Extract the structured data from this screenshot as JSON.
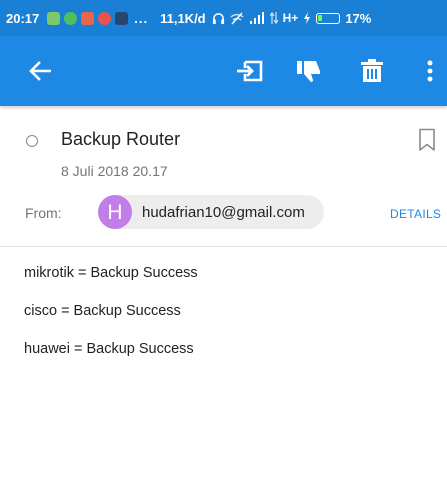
{
  "status_bar": {
    "time": "20:17",
    "overflow": "...",
    "network_speed": "11,1K/d",
    "network_type": "H+",
    "battery": "17%",
    "colors": {
      "background": "#1a80d6",
      "battery_fill": "#7cf26b"
    },
    "notification_icons": [
      "app-notification-icon",
      "whatsapp-icon",
      "app-notification-icon",
      "app-notification-icon",
      "app-notification-icon"
    ],
    "system_icons": [
      "headset-icon",
      "wifi-off-icon",
      "signal-icon",
      "data-transfer-icon",
      "charging-icon",
      "battery-icon"
    ]
  },
  "app_bar": {
    "color": "#1e88e5",
    "actions": [
      "back-arrow-icon",
      "move-to-icon",
      "thumb-down-icon",
      "trash-icon",
      "overflow-menu-icon"
    ]
  },
  "message": {
    "subject": "Backup Router",
    "date": "8 Juli 2018 20.17",
    "from_label": "From:",
    "sender_initial": "H",
    "sender_email": "hudafrian10@gmail.com",
    "avatar_color": "#c17de8",
    "details_label": "DETAILS",
    "body_lines": [
      "mikrotik = Backup Success",
      "cisco = Backup Success",
      "huawei = Backup Success"
    ]
  }
}
